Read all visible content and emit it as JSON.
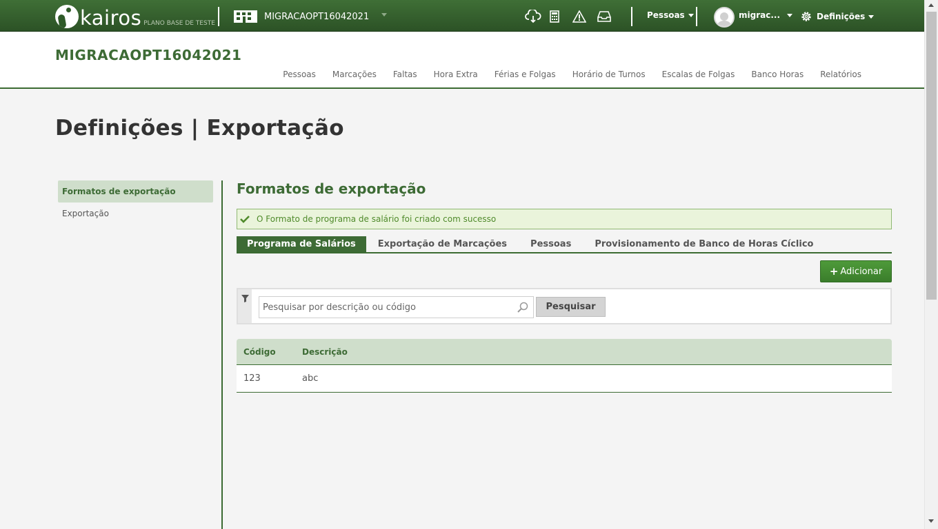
{
  "topbar": {
    "logo_text": "kairos",
    "logo_sub": "PLANO BASE DE TESTE",
    "company": "MIGRACAOPT16042021",
    "icons": [
      "cloud-download-icon",
      "calculator-icon",
      "warning-icon",
      "inbox-icon"
    ],
    "people_menu": "Pessoas",
    "user_menu": "migrac...",
    "settings_menu": "Definições"
  },
  "header": {
    "title": "MIGRACAOPT16042021",
    "nav": [
      "Pessoas",
      "Marcações",
      "Faltas",
      "Hora Extra",
      "Férias e Folgas",
      "Horário de Turnos",
      "Escalas de Folgas",
      "Banco Horas",
      "Relatórios"
    ]
  },
  "page": {
    "title": "Definições | Exportação"
  },
  "sidebar": {
    "items": [
      {
        "label": "Formatos de exportação",
        "active": true
      },
      {
        "label": "Exportação",
        "active": false
      }
    ]
  },
  "main": {
    "section_title": "Formatos de exportação",
    "alert": "O Formato de programa de salário foi criado com sucesso",
    "tabs": [
      {
        "label": "Programa de Salários",
        "active": true
      },
      {
        "label": "Exportação de Marcações",
        "active": false
      },
      {
        "label": "Pessoas",
        "active": false
      },
      {
        "label": "Provisionamento de Banco de Horas Cíclico",
        "active": false
      }
    ],
    "add_button": "Adicionar",
    "search": {
      "placeholder": "Pesquisar por descrição ou código",
      "value": "",
      "button": "Pesquisar"
    },
    "table": {
      "headers": [
        "Código",
        "Descrição"
      ],
      "rows": [
        [
          "123",
          "abc"
        ]
      ]
    }
  },
  "colors": {
    "brand_green": "#3d6b35",
    "accent_light": "#cfdecb",
    "success_bg": "#eaf4db",
    "button_green": "#44892f"
  }
}
